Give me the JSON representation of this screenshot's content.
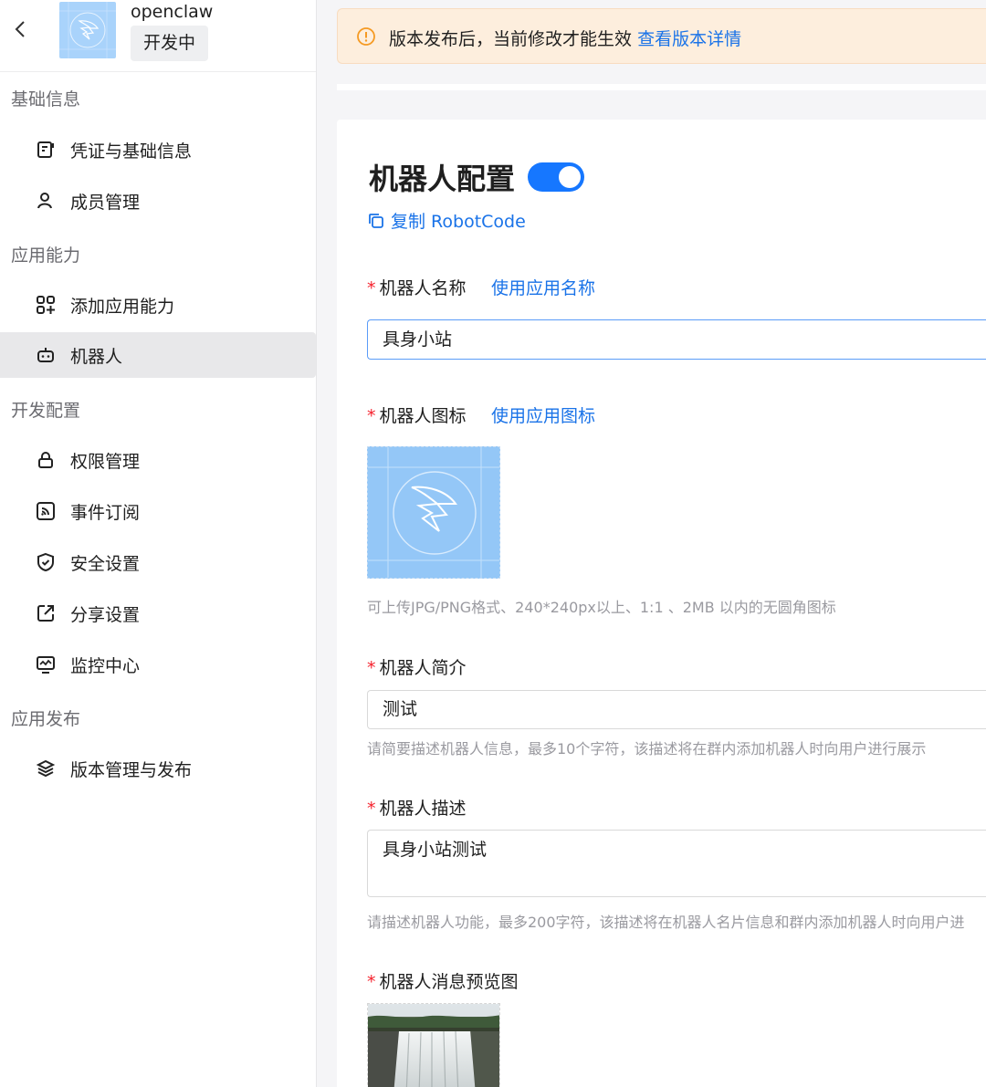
{
  "app": {
    "name": "openclaw",
    "status": "开发中"
  },
  "sidebar": {
    "sections": [
      {
        "title": "基础信息",
        "items": [
          {
            "label": "凭证与基础信息",
            "icon": "credential-icon"
          },
          {
            "label": "成员管理",
            "icon": "user-icon"
          }
        ]
      },
      {
        "title": "应用能力",
        "items": [
          {
            "label": "添加应用能力",
            "icon": "add-capability-icon"
          },
          {
            "label": "机器人",
            "icon": "robot-icon",
            "active": true
          }
        ]
      },
      {
        "title": "开发配置",
        "items": [
          {
            "label": "权限管理",
            "icon": "lock-icon"
          },
          {
            "label": "事件订阅",
            "icon": "rss-icon"
          },
          {
            "label": "安全设置",
            "icon": "shield-icon"
          },
          {
            "label": "分享设置",
            "icon": "share-icon"
          },
          {
            "label": "监控中心",
            "icon": "monitor-icon"
          }
        ]
      },
      {
        "title": "应用发布",
        "items": [
          {
            "label": "版本管理与发布",
            "icon": "layers-icon"
          }
        ]
      }
    ]
  },
  "notice": {
    "text": "版本发布后，当前修改才能生效",
    "link": "查看版本详情"
  },
  "config": {
    "title": "机器人配置",
    "enabled": true,
    "copy_label": "复制 RobotCode",
    "name_field": {
      "label": "机器人名称",
      "link": "使用应用名称",
      "value": "具身小站"
    },
    "icon_field": {
      "label": "机器人图标",
      "link": "使用应用图标",
      "hint": "可上传JPG/PNG格式、240*240px以上、1:1 、2MB 以内的无圆角图标"
    },
    "intro_field": {
      "label": "机器人简介",
      "value": "测试",
      "hint": "请简要描述机器人信息，最多10个字符，该描述将在群内添加机器人时向用户进行展示"
    },
    "desc_field": {
      "label": "机器人描述",
      "value": "具身小站测试",
      "hint": "请描述机器人功能，最多200字符，该描述将在机器人名片信息和群内添加机器人时向用户进"
    },
    "preview_field": {
      "label": "机器人消息预览图"
    },
    "required_mark": "*"
  },
  "colors": {
    "accent": "#1677ff",
    "link": "#1a73e8",
    "required": "#f5222d",
    "notice_bg": "#fdeedd",
    "notice_icon": "#f59a23"
  }
}
